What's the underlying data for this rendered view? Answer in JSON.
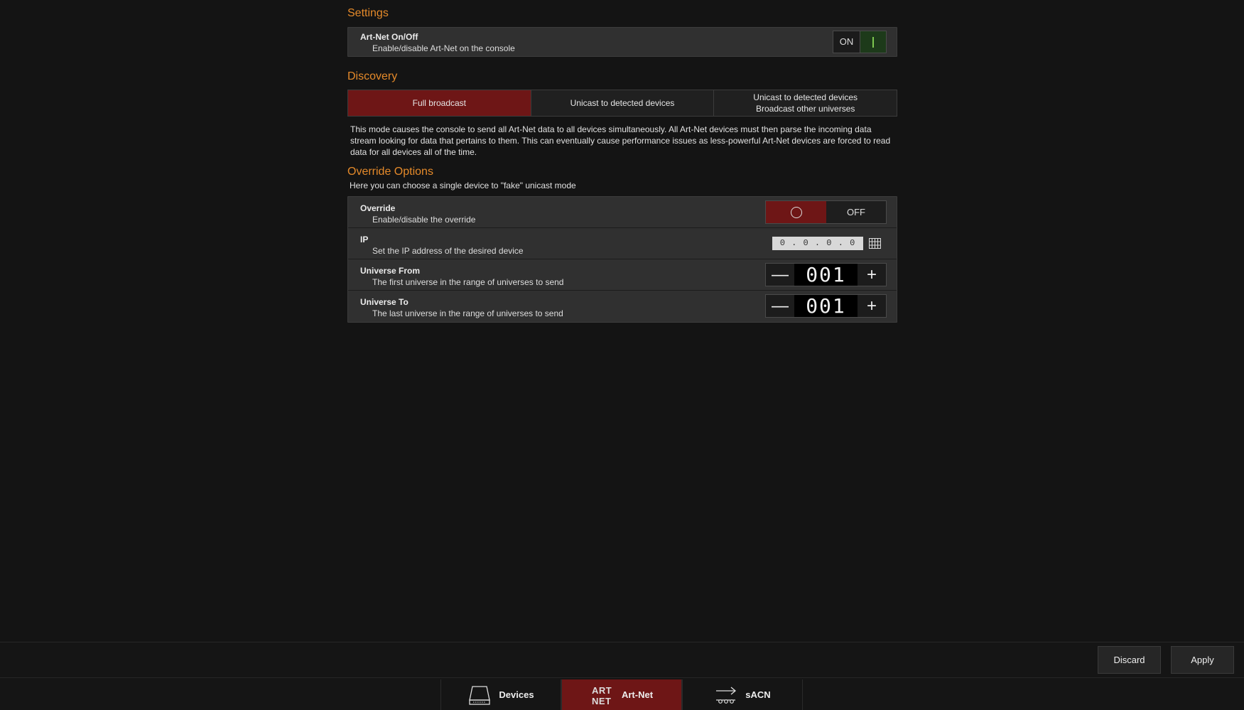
{
  "settings": {
    "title": "Settings",
    "artnet": {
      "title": "Art-Net On/Off",
      "desc": "Enable/disable Art-Net on the console",
      "state_label": "ON"
    }
  },
  "discovery": {
    "title": "Discovery",
    "modes": [
      {
        "line1": "Full broadcast",
        "line2": "",
        "active": true
      },
      {
        "line1": "Unicast to detected devices",
        "line2": "",
        "active": false
      },
      {
        "line1": "Unicast to detected devices",
        "line2": "Broadcast other universes",
        "active": false
      }
    ],
    "description": "This mode causes the console to send all Art-Net data to all devices simultaneously. All Art-Net devices must then parse the incoming data stream looking for data that pertains to them. This can eventually cause performance issues as less-powerful Art-Net devices are forced to read data for all devices all of the time."
  },
  "override": {
    "title": "Override Options",
    "subtitle": "Here you can choose a single device to \"fake\" unicast mode",
    "toggle": {
      "title": "Override",
      "desc": "Enable/disable the override",
      "state_label": "OFF"
    },
    "ip": {
      "title": "IP",
      "desc": "Set the IP address of the desired device",
      "value": "0 . 0 . 0 . 0"
    },
    "universe_from": {
      "title": "Universe From",
      "desc": "The first universe in the range of universes to send",
      "value": "001",
      "minus": "—",
      "plus": "+"
    },
    "universe_to": {
      "title": "Universe To",
      "desc": "The last universe in the range of universes to send",
      "value": "001",
      "minus": "—",
      "plus": "+"
    }
  },
  "actions": {
    "discard": "Discard",
    "apply": "Apply"
  },
  "tabs": [
    {
      "label": "Devices",
      "icon": "drive-icon",
      "active": false
    },
    {
      "label": "Art-Net",
      "icon": "artnet-logo-icon",
      "active": true
    },
    {
      "label": "sACN",
      "icon": "sacn-arrow-icon",
      "active": false
    }
  ],
  "colors": {
    "accent": "#e58a2a",
    "active_red": "#6e1616",
    "on_green": "#1d3a1a"
  }
}
